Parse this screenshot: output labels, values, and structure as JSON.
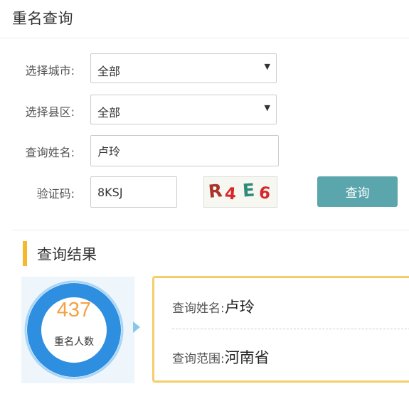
{
  "page": {
    "title": "重名查询"
  },
  "form": {
    "city": {
      "label": "选择城市:",
      "value": "全部"
    },
    "county": {
      "label": "选择县区:",
      "value": "全部"
    },
    "name": {
      "label": "查询姓名:",
      "value": "卢玲"
    },
    "captcha": {
      "label": "验证码:",
      "value": "8KSJ",
      "image_chars": [
        {
          "char": "R",
          "color": "#a8342b"
        },
        {
          "char": "4",
          "color": "#d8262a"
        },
        {
          "char": "E",
          "color": "#2f8a77"
        },
        {
          "char": "6",
          "color": "#d8262a"
        }
      ]
    },
    "query_button_label": "查询"
  },
  "result": {
    "section_title": "查询结果",
    "count": "437",
    "count_label": "重名人数",
    "name_key": "查询姓名:",
    "name_value": "卢玲",
    "range_key": "查询范围:",
    "range_value": "河南省"
  },
  "icons": {
    "select_caret": "caret-down-icon"
  },
  "colors": {
    "button": "#5ba6ac",
    "accent": "#f5b82e",
    "count": "#f5a243",
    "ring": "#2e8fe0",
    "card_border": "#f5cd6a"
  }
}
